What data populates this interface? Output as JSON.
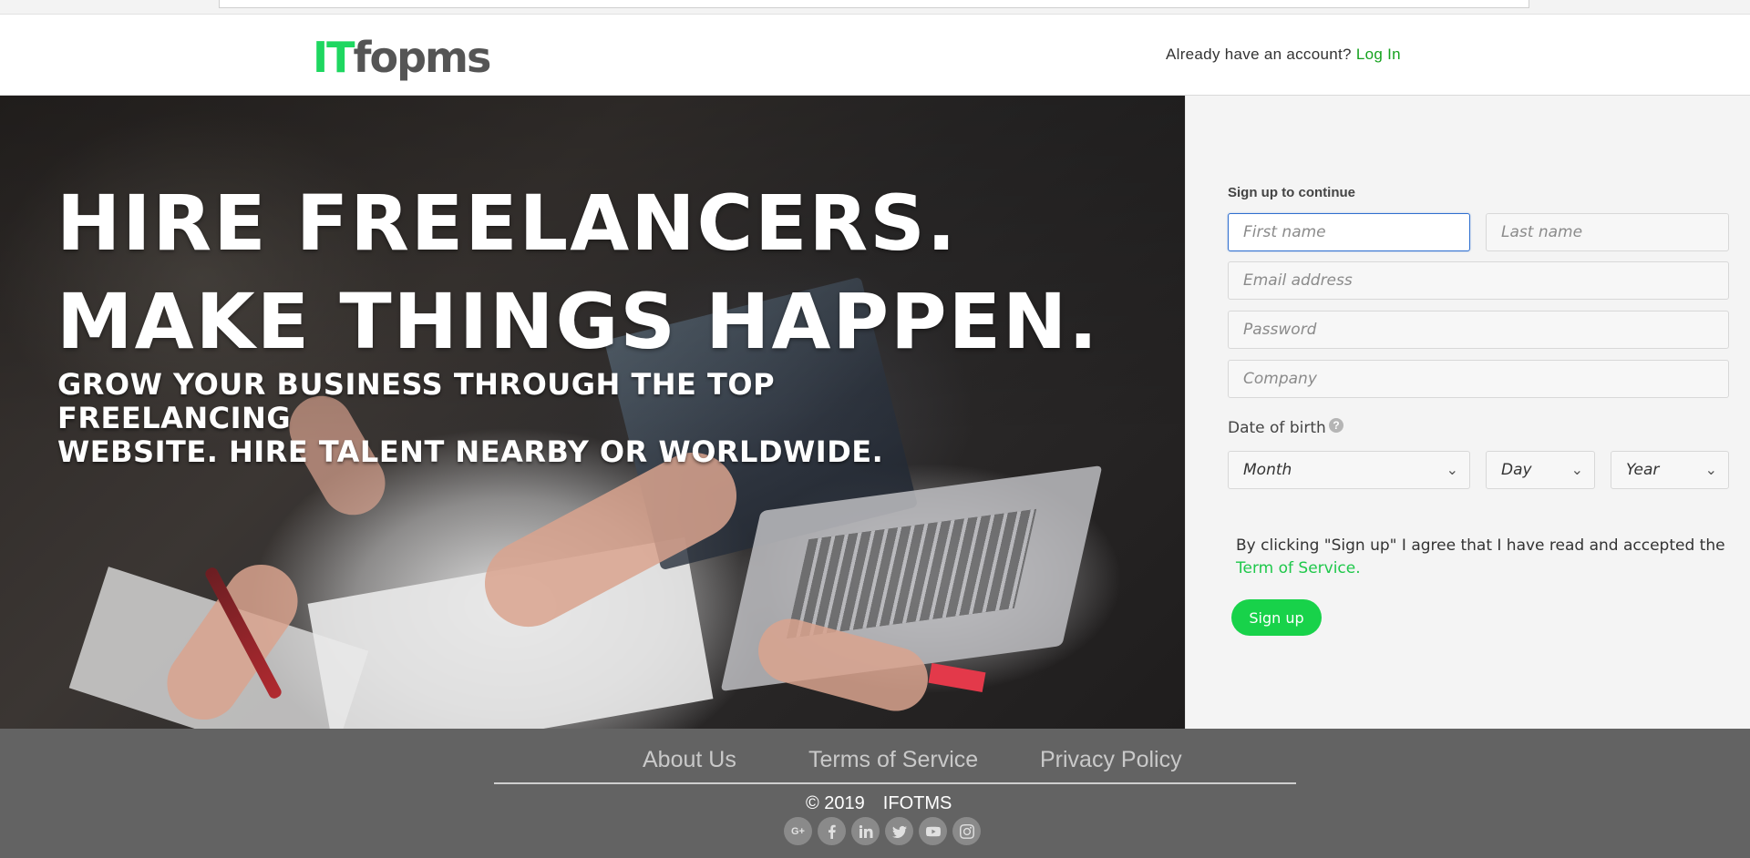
{
  "header": {
    "logo_it": "IT",
    "logo_rest": "fopms",
    "login_prompt": "Already have an account?",
    "login_link": "Log In"
  },
  "hero": {
    "line1": "HIRE FREELANCERS.",
    "line2": "MAKE THINGS HAPPEN.",
    "sub1": "GROW YOUR BUSINESS THROUGH THE TOP FREELANCING",
    "sub2": "WEBSITE. HIRE TALENT NEARBY OR WORLDWIDE."
  },
  "form": {
    "title": "Sign up to continue",
    "first_name_placeholder": "First name",
    "last_name_placeholder": "Last name",
    "email_placeholder": "Email address",
    "password_placeholder": "Password",
    "company_placeholder": "Company",
    "dob_label": "Date of birth",
    "help_glyph": "?",
    "month_label": "Month",
    "day_label": "Day",
    "year_label": "Year",
    "terms_text": "By clicking \"Sign up\" I agree that I have read and accepted the ",
    "terms_link": "Term of Service.",
    "signup_label": "Sign up",
    "accent_color": "#18d24a"
  },
  "footer": {
    "links": [
      "About Us",
      "Terms of Service",
      "Privacy Policy"
    ],
    "copyright_symbol_year": "© 2019",
    "copyright_name": "IFOTMS",
    "socials": [
      "google-plus-icon",
      "facebook-icon",
      "linkedin-icon",
      "twitter-icon",
      "youtube-icon",
      "instagram-icon"
    ]
  }
}
